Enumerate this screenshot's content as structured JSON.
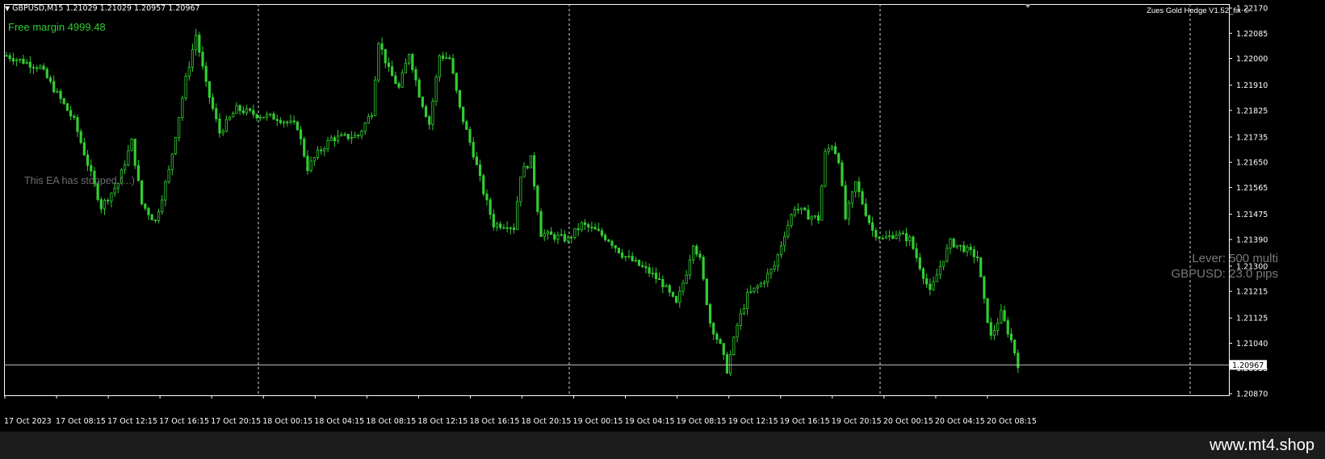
{
  "chart": {
    "symbol_header": "GBPUSD,M15",
    "ohlc": "1.21029 1.21029 1.20957 1.20967",
    "free_margin": "Free margin 4999.48",
    "ea_name": "Zues Gold Hedge V1.52_fix",
    "stopped_message": "This EA has stopped (...)",
    "lever_text": "Lever: 500 multi",
    "pips_text": "GBPUSD: 23.0 pips",
    "current_price": "1.20967",
    "colors": {
      "candles": "#32cd32",
      "grid": "#d8d8d8",
      "axis": "#ffffff",
      "background": "#000000"
    }
  },
  "chart_data": {
    "type": "bar",
    "title": "",
    "price_axis": [
      "1.22170",
      "1.22085",
      "1.22000",
      "1.21910",
      "1.21825",
      "1.21735",
      "1.21650",
      "1.21565",
      "1.21475",
      "1.21390",
      "1.21300",
      "1.21215",
      "1.21125",
      "1.21040",
      "1.20955",
      "1.20870"
    ],
    "time_axis": [
      "17 Oct 2023",
      "17 Oct 08:15",
      "17 Oct 12:15",
      "17 Oct 16:15",
      "17 Oct 20:15",
      "18 Oct 00:15",
      "18 Oct 04:15",
      "18 Oct 08:15",
      "18 Oct 12:15",
      "18 Oct 16:15",
      "18 Oct 20:15",
      "19 Oct 00:15",
      "19 Oct 04:15",
      "19 Oct 08:15",
      "19 Oct 12:15",
      "19 Oct 16:15",
      "19 Oct 20:15",
      "20 Oct 00:15",
      "20 Oct 04:15",
      "20 Oct 08:15"
    ],
    "ylim": [
      1.2084,
      1.2218
    ],
    "close_path": [
      {
        "t": 0,
        "p": 1.2201
      },
      {
        "t": 10,
        "p": 1.2197
      },
      {
        "t": 20,
        "p": 1.2179
      },
      {
        "t": 28,
        "p": 1.215
      },
      {
        "t": 33,
        "p": 1.2158
      },
      {
        "t": 37,
        "p": 1.2172
      },
      {
        "t": 40,
        "p": 1.2151
      },
      {
        "t": 44,
        "p": 1.2145
      },
      {
        "t": 48,
        "p": 1.2162
      },
      {
        "t": 53,
        "p": 1.2193
      },
      {
        "t": 56,
        "p": 1.2208
      },
      {
        "t": 59,
        "p": 1.2191
      },
      {
        "t": 63,
        "p": 1.2175
      },
      {
        "t": 68,
        "p": 1.2183
      },
      {
        "t": 74,
        "p": 1.2181
      },
      {
        "t": 80,
        "p": 1.218
      },
      {
        "t": 86,
        "p": 1.2177
      },
      {
        "t": 89,
        "p": 1.2163
      },
      {
        "t": 92,
        "p": 1.2168
      },
      {
        "t": 96,
        "p": 1.2173
      },
      {
        "t": 104,
        "p": 1.2174
      },
      {
        "t": 108,
        "p": 1.2182
      },
      {
        "t": 110,
        "p": 1.2206
      },
      {
        "t": 113,
        "p": 1.2196
      },
      {
        "t": 116,
        "p": 1.219
      },
      {
        "t": 119,
        "p": 1.2202
      },
      {
        "t": 122,
        "p": 1.2188
      },
      {
        "t": 125,
        "p": 1.2178
      },
      {
        "t": 128,
        "p": 1.2201
      },
      {
        "t": 131,
        "p": 1.22
      },
      {
        "t": 134,
        "p": 1.2183
      },
      {
        "t": 138,
        "p": 1.2168
      },
      {
        "t": 141,
        "p": 1.2155
      },
      {
        "t": 144,
        "p": 1.2144
      },
      {
        "t": 148,
        "p": 1.2144
      },
      {
        "t": 150,
        "p": 1.2143
      },
      {
        "t": 152,
        "p": 1.2161
      },
      {
        "t": 155,
        "p": 1.2166
      },
      {
        "t": 158,
        "p": 1.2141
      },
      {
        "t": 162,
        "p": 1.214
      },
      {
        "t": 166,
        "p": 1.2139
      },
      {
        "t": 170,
        "p": 1.2144
      },
      {
        "t": 174,
        "p": 1.2142
      },
      {
        "t": 178,
        "p": 1.2139
      },
      {
        "t": 182,
        "p": 1.2134
      },
      {
        "t": 186,
        "p": 1.2131
      },
      {
        "t": 190,
        "p": 1.2128
      },
      {
        "t": 194,
        "p": 1.2124
      },
      {
        "t": 198,
        "p": 1.2117
      },
      {
        "t": 201,
        "p": 1.2128
      },
      {
        "t": 203,
        "p": 1.2138
      },
      {
        "t": 205,
        "p": 1.2132
      },
      {
        "t": 208,
        "p": 1.2111
      },
      {
        "t": 211,
        "p": 1.2103
      },
      {
        "t": 213,
        "p": 1.2095
      },
      {
        "t": 216,
        "p": 1.211
      },
      {
        "t": 219,
        "p": 1.212
      },
      {
        "t": 223,
        "p": 1.2124
      },
      {
        "t": 227,
        "p": 1.213
      },
      {
        "t": 230,
        "p": 1.2141
      },
      {
        "t": 233,
        "p": 1.215
      },
      {
        "t": 237,
        "p": 1.2147
      },
      {
        "t": 240,
        "p": 1.2146
      },
      {
        "t": 242,
        "p": 1.2168
      },
      {
        "t": 244,
        "p": 1.2171
      },
      {
        "t": 246,
        "p": 1.2166
      },
      {
        "t": 248,
        "p": 1.2146
      },
      {
        "t": 251,
        "p": 1.2158
      },
      {
        "t": 254,
        "p": 1.2148
      },
      {
        "t": 256,
        "p": 1.2142
      },
      {
        "t": 259,
        "p": 1.2139
      },
      {
        "t": 263,
        "p": 1.2141
      },
      {
        "t": 267,
        "p": 1.2139
      },
      {
        "t": 270,
        "p": 1.213
      },
      {
        "t": 273,
        "p": 1.2121
      },
      {
        "t": 276,
        "p": 1.213
      },
      {
        "t": 279,
        "p": 1.2138
      },
      {
        "t": 283,
        "p": 1.2136
      },
      {
        "t": 287,
        "p": 1.2133
      },
      {
        "t": 289,
        "p": 1.2118
      },
      {
        "t": 291,
        "p": 1.2106
      },
      {
        "t": 294,
        "p": 1.2114
      },
      {
        "t": 297,
        "p": 1.2105
      },
      {
        "t": 299,
        "p": 1.2097
      }
    ],
    "current_price": 1.20967
  }
}
